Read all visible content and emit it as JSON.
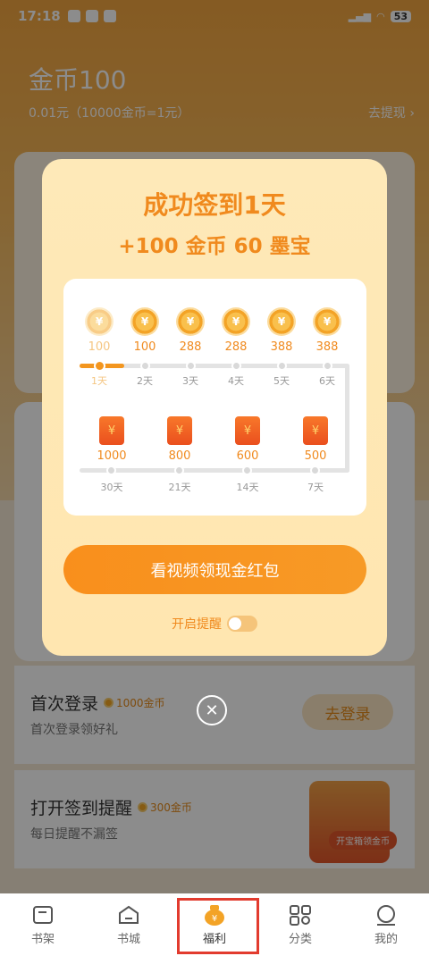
{
  "status": {
    "time": "17:18",
    "battery": "53"
  },
  "header": {
    "coin_title": "金币100",
    "rate": "0.01元（10000金币=1元）",
    "withdraw": "去提现 ›"
  },
  "modal": {
    "title": "成功签到1天",
    "subtitle": "+100 金币 60 墨宝",
    "row1": [
      {
        "amt": "100",
        "day": "1天"
      },
      {
        "amt": "100",
        "day": "2天"
      },
      {
        "amt": "288",
        "day": "3天"
      },
      {
        "amt": "288",
        "day": "4天"
      },
      {
        "amt": "388",
        "day": "5天"
      },
      {
        "amt": "388",
        "day": "6天"
      }
    ],
    "row2": [
      {
        "amt": "1000",
        "day": "30天"
      },
      {
        "amt": "800",
        "day": "21天"
      },
      {
        "amt": "600",
        "day": "14天"
      },
      {
        "amt": "500",
        "day": "7天"
      }
    ],
    "cta": "看视频领现金红包",
    "remind": "开启提醒"
  },
  "tasks": [
    {
      "title": "首次登录",
      "reward": "1000金币",
      "sub": "首次登录领好礼",
      "btn": "去登录"
    },
    {
      "title": "打开签到提醒",
      "reward": "300金币",
      "sub": "每日提醒不漏签",
      "chest": "开宝箱领金币"
    }
  ],
  "tabs": [
    "书架",
    "书城",
    "福利",
    "分类",
    "我的"
  ],
  "colors": {
    "accent": "#f3961f",
    "highlight": "#e23b2e"
  }
}
